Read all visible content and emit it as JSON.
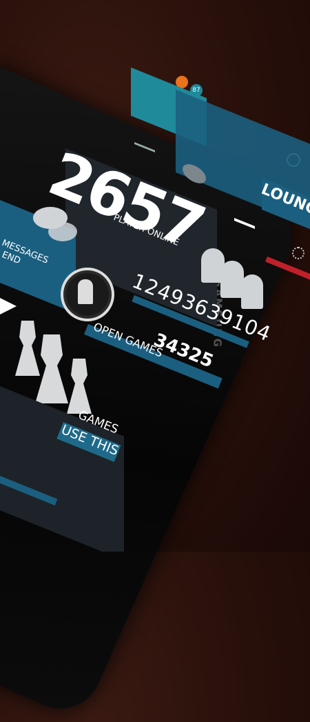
{
  "status": {
    "battery": "87"
  },
  "header": {
    "nav_label": "LOUNGE"
  },
  "stats": {
    "players_count": "2657",
    "players_label": "PLAYER ONLINE",
    "total_number": "12493639104",
    "open_games_count": "34325",
    "open_games_label": "OPEN GAMES"
  },
  "tiles": {
    "messages_label": "MESSAGES",
    "friend_label": "END",
    "games_label": "GAMES",
    "use_this_label": "USE THIS"
  },
  "colors": {
    "teal": "#1f8a9a",
    "blue": "#1b5f80",
    "panel": "#20262c",
    "red": "#c0202a"
  }
}
